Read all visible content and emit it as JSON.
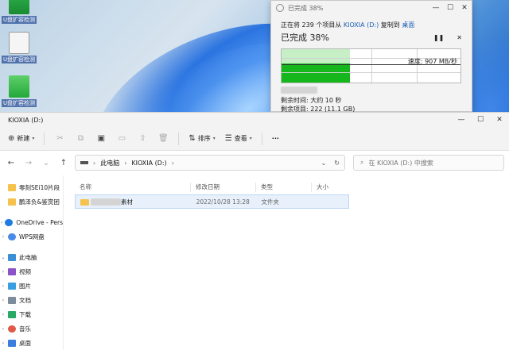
{
  "desktop": {
    "icons": [
      {
        "label": "U盘扩容检测"
      },
      {
        "label": "U盘扩容检测"
      },
      {
        "label": "U盘扩容检测"
      }
    ]
  },
  "copy_dialog": {
    "title": "已完成 38%",
    "status_prefix": "正在将 239 个项目从",
    "source": "KIOXIA (D:)",
    "status_mid": "复制到",
    "destination": "桌面",
    "percent_label": "已完成 38%",
    "progress": 0.38,
    "speed": "速度: 907 MB/秒",
    "file_name": "",
    "time_remaining": "剩余时间: 大约 10 秒",
    "items_remaining": "剩余项目: 222 (11.1 GB)"
  },
  "explorer": {
    "title": "KIOXIA (D:)",
    "toolbar": {
      "new_label": "新建",
      "sort_label": "排序",
      "view_label": "查看",
      "more_label": "···"
    },
    "breadcrumb": [
      "此电脑",
      "KIOXIA (D:)"
    ],
    "search_placeholder": "在 KIOXIA (D:) 中搜索",
    "sidebar": {
      "quick": [
        {
          "label": "零刻SEi10片段"
        },
        {
          "label": "鹏泽负&鉴赏团"
        }
      ],
      "cloud": [
        {
          "label": "OneDrive - Pers"
        },
        {
          "label": "WPS网盘"
        }
      ],
      "pc_label": "此电脑",
      "pc_items": [
        {
          "label": "视频"
        },
        {
          "label": "图片"
        },
        {
          "label": "文档"
        },
        {
          "label": "下载"
        },
        {
          "label": "音乐"
        },
        {
          "label": "桌面"
        }
      ]
    },
    "columns": [
      "名称",
      "修改日期",
      "类型",
      "大小"
    ],
    "files": [
      {
        "name_suffix": "素材",
        "modified": "2022/10/28 13:28",
        "type": "文件夹",
        "size": ""
      }
    ]
  }
}
